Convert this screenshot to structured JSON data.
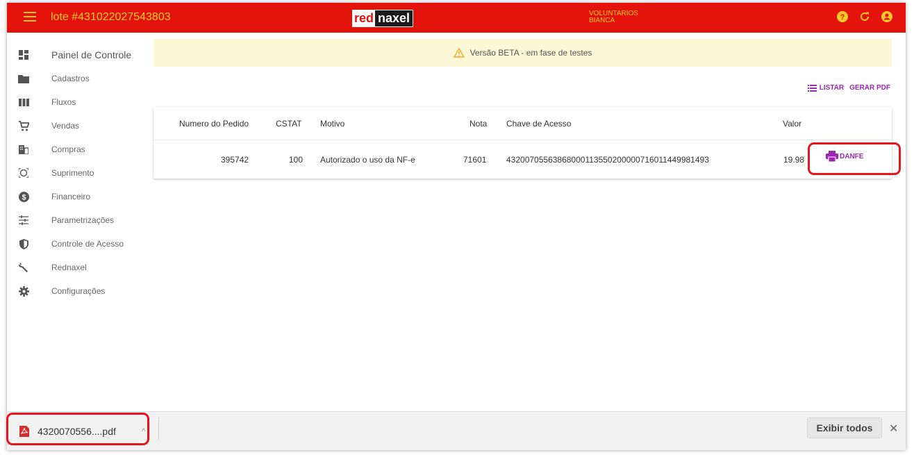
{
  "header": {
    "lote": "lote #431022027543803",
    "logo_red": "red",
    "logo_naxel": "naxel",
    "company_line1": "VOLUNTARIOS",
    "company_line2": "BIANCA"
  },
  "sidebar": {
    "items": [
      {
        "label": "Painel de Controle",
        "icon": "dashboard-icon"
      },
      {
        "label": "Cadastros",
        "icon": "folder-icon"
      },
      {
        "label": "Fluxos",
        "icon": "columns-icon"
      },
      {
        "label": "Vendas",
        "icon": "cart-icon"
      },
      {
        "label": "Compras",
        "icon": "building-icon"
      },
      {
        "label": "Suprimento",
        "icon": "target-icon"
      },
      {
        "label": "Financeiro",
        "icon": "money-icon"
      },
      {
        "label": "Parametrizações",
        "icon": "sliders-icon"
      },
      {
        "label": "Controle de Acesso",
        "icon": "shield-icon"
      },
      {
        "label": "Rednaxel",
        "icon": "wrench-icon"
      },
      {
        "label": "Configurações",
        "icon": "gear-icon"
      }
    ]
  },
  "beta_notice": "Versão BETA - em fase de testes",
  "actions": {
    "listar": "LISTAR",
    "gerar_pdf": "GERAR PDF"
  },
  "table": {
    "columns": [
      "Numero do Pedido",
      "CSTAT",
      "Motivo",
      "Nota",
      "Chave de Acesso",
      "Valor"
    ],
    "rows": [
      {
        "pedido": "395742",
        "cstat": "100",
        "motivo": "Autorizado o uso da NF-e",
        "nota": "71601",
        "chave": "43200705563868000113550200000716011449981493",
        "valor": "19.98",
        "action": "DANFE"
      }
    ]
  },
  "download_bar": {
    "file_name": "4320070556....pdf",
    "show_all": "Exibir todos",
    "close": "✕"
  },
  "colors": {
    "header_bg": "#e3120b",
    "header_text": "#ffca28",
    "accent": "#9c27b0",
    "highlight": "#e8141b"
  }
}
